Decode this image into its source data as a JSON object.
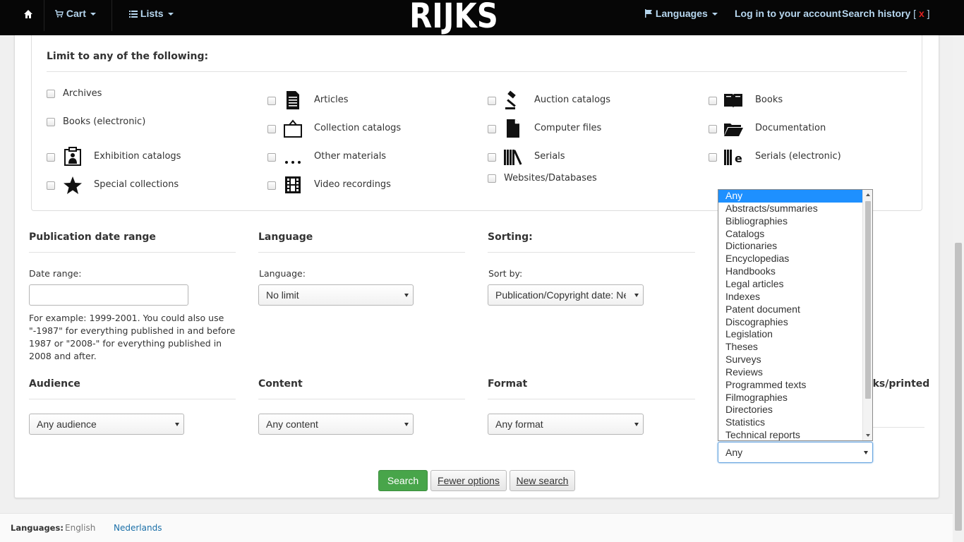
{
  "navbar": {
    "home_icon": "home-icon",
    "cart": "Cart",
    "lists": "Lists",
    "brand": "RIJKS MUSEUM",
    "languages": "Languages",
    "login": "Log in to your account",
    "search_history": "Search history",
    "history_clear_open": "[",
    "history_clear_x": "x",
    "history_clear_close": "]"
  },
  "limit": {
    "title": "Limit to any of the following:",
    "formats": [
      {
        "label": "Archives",
        "icon": "none"
      },
      {
        "label": "Articles",
        "icon": "article-icon"
      },
      {
        "label": "Auction catalogs",
        "icon": "gavel-icon"
      },
      {
        "label": "Books",
        "icon": "book-icon"
      },
      {
        "label": "Books (electronic)",
        "icon": "none"
      },
      {
        "label": "Collection catalogs",
        "icon": "collection-icon"
      },
      {
        "label": "Computer files",
        "icon": "file-icon"
      },
      {
        "label": "Documentation",
        "icon": "folder-icon"
      },
      {
        "label": "Exhibition catalogs",
        "icon": "exhibition-icon"
      },
      {
        "label": "Other materials",
        "icon": "ellipsis-icon"
      },
      {
        "label": "Serials",
        "icon": "serials-icon"
      },
      {
        "label": "Serials (electronic)",
        "icon": "eserials-icon"
      },
      {
        "label": "Special collections",
        "icon": "star-icon"
      },
      {
        "label": "Video recordings",
        "icon": "film-icon"
      },
      {
        "label": "Websites/Databases",
        "icon": "none"
      }
    ]
  },
  "pubdate": {
    "title": "Publication date range",
    "label": "Date range:",
    "value": "",
    "help": "For example: 1999-2001. You could also use \"-1987\" for everything published in and before 1987 or \"2008-\" for everything published in 2008 and after."
  },
  "language": {
    "title": "Language",
    "label": "Language:",
    "value": "No limit"
  },
  "sorting": {
    "title": "Sorting:",
    "label": "Sort by:",
    "value": "Publication/Copyright date: Ne"
  },
  "audience": {
    "title": "Audience",
    "value": "Any audience"
  },
  "content": {
    "title": "Content",
    "value": "Any content"
  },
  "format": {
    "title": "Format",
    "value": "Any format"
  },
  "nature": {
    "title_fragment": "oks/printed",
    "value": "Any",
    "options": [
      "Any",
      "Abstracts/summaries",
      "Bibliographies",
      "Catalogs",
      "Dictionaries",
      "Encyclopedias",
      "Handbooks",
      "Legal articles",
      "Indexes",
      "Patent document",
      "Discographies",
      "Legislation",
      "Theses",
      "Surveys",
      "Reviews",
      "Programmed texts",
      "Filmographies",
      "Directories",
      "Statistics",
      "Technical reports"
    ],
    "selected_index": 0
  },
  "buttons": {
    "search": "Search",
    "fewer": "Fewer options",
    "new_search": "New search"
  },
  "footer": {
    "label": "Languages:",
    "english": "English",
    "dutch": "Nederlands"
  },
  "colors": {
    "navbar": "#060606",
    "link": "#b6d6ee",
    "search_button": "#48a54a",
    "highlight": "#1e90ff"
  }
}
